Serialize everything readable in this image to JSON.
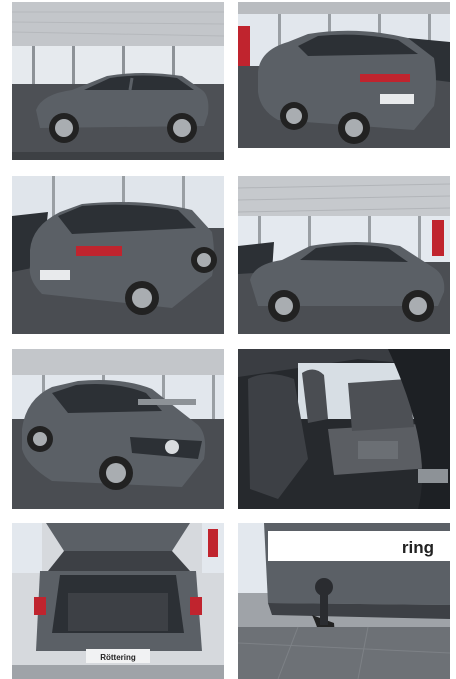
{
  "gallery": {
    "photos": [
      {
        "id": "photo-1",
        "view": "side-left"
      },
      {
        "id": "photo-2",
        "view": "rear-quarter-right"
      },
      {
        "id": "photo-3",
        "view": "rear-quarter-left"
      },
      {
        "id": "photo-4",
        "view": "side-left-showroom"
      },
      {
        "id": "photo-5",
        "view": "front-quarter-left"
      },
      {
        "id": "photo-6",
        "view": "rear-seats-interior"
      },
      {
        "id": "photo-7",
        "view": "trunk-open"
      },
      {
        "id": "photo-8",
        "view": "tow-hitch"
      }
    ],
    "plates": {
      "trunk_plate": "Röttering",
      "hitch_plate": "ring"
    },
    "colors": {
      "car_body": "#5b6066",
      "car_dark": "#2c3035",
      "floor": "#4a4d52",
      "ceiling": "#c9ccd0",
      "window": "#e3e8ee",
      "tail_light": "#c0242e"
    }
  }
}
